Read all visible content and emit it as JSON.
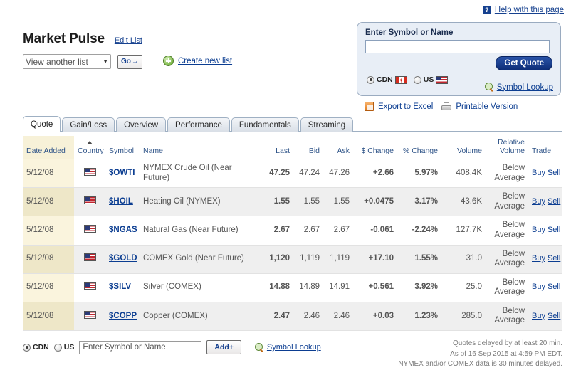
{
  "help": {
    "icon": "question-mark-icon",
    "label": "Help with this page"
  },
  "header": {
    "title": "Market Pulse",
    "edit_list_label": "Edit List",
    "list_select_value": "View another list",
    "go_label": "Go",
    "go_arrow": "→",
    "create_new_list_label": "Create new list"
  },
  "quote_box": {
    "label": "Enter Symbol or Name",
    "input_value": "",
    "get_quote_label": "Get Quote",
    "radio_cdn_label": "CDN",
    "radio_us_label": "US",
    "selected_market": "CDN",
    "symbol_lookup_label": "Symbol Lookup"
  },
  "export": {
    "excel_label": "Export to Excel",
    "printable_label": "Printable Version"
  },
  "tabs": [
    {
      "label": "Quote",
      "active": true
    },
    {
      "label": "Gain/Loss",
      "active": false
    },
    {
      "label": "Overview",
      "active": false
    },
    {
      "label": "Performance",
      "active": false
    },
    {
      "label": "Fundamentals",
      "active": false
    },
    {
      "label": "Streaming",
      "active": false
    }
  ],
  "table": {
    "columns": {
      "date_added": "Date Added",
      "country": "Country",
      "symbol": "Symbol",
      "name": "Name",
      "last": "Last",
      "bid": "Bid",
      "ask": "Ask",
      "dollar_change": "$ Change",
      "percent_change": "% Change",
      "volume": "Volume",
      "relative_volume": "Relative Volume",
      "trade": "Trade"
    },
    "sorted_by": "Date Added",
    "sort_direction": "asc",
    "trade_buy_label": "Buy",
    "trade_sell_label": "Sell",
    "rows": [
      {
        "date_added": "5/12/08",
        "country": "US",
        "symbol": "$OWTI",
        "name": "NYMEX Crude Oil (Near Future)",
        "last": "47.25",
        "bid": "47.24",
        "ask": "47.26",
        "dollar_change": "+2.66",
        "percent_change": "5.97%",
        "direction": "up",
        "volume": "408.4K",
        "relative_volume": "Below Average"
      },
      {
        "date_added": "5/12/08",
        "country": "US",
        "symbol": "$HOIL",
        "name": "Heating Oil (NYMEX)",
        "last": "1.55",
        "bid": "1.55",
        "ask": "1.55",
        "dollar_change": "+0.0475",
        "percent_change": "3.17%",
        "direction": "up",
        "volume": "43.6K",
        "relative_volume": "Below Average"
      },
      {
        "date_added": "5/12/08",
        "country": "US",
        "symbol": "$NGAS",
        "name": "Natural Gas (Near Future)",
        "last": "2.67",
        "bid": "2.67",
        "ask": "2.67",
        "dollar_change": "-0.061",
        "percent_change": "-2.24%",
        "direction": "down",
        "volume": "127.7K",
        "relative_volume": "Below Average"
      },
      {
        "date_added": "5/12/08",
        "country": "US",
        "symbol": "$GOLD",
        "name": "COMEX Gold (Near Future)",
        "last": "1,120",
        "bid": "1,119",
        "ask": "1,119",
        "dollar_change": "+17.10",
        "percent_change": "1.55%",
        "direction": "up",
        "volume": "31.0",
        "relative_volume": "Below Average"
      },
      {
        "date_added": "5/12/08",
        "country": "US",
        "symbol": "$SILV",
        "name": "Silver (COMEX)",
        "last": "14.88",
        "bid": "14.89",
        "ask": "14.91",
        "dollar_change": "+0.561",
        "percent_change": "3.92%",
        "direction": "up",
        "volume": "25.0",
        "relative_volume": "Below Average"
      },
      {
        "date_added": "5/12/08",
        "country": "US",
        "symbol": "$COPP",
        "name": "Copper (COMEX)",
        "last": "2.47",
        "bid": "2.46",
        "ask": "2.46",
        "dollar_change": "+0.03",
        "percent_change": "1.23%",
        "direction": "up",
        "volume": "285.0",
        "relative_volume": "Below Average"
      }
    ]
  },
  "add_bar": {
    "radio_cdn_label": "CDN",
    "radio_us_label": "US",
    "selected_market": "CDN",
    "input_placeholder": "Enter Symbol or Name",
    "input_value": "",
    "add_label": "Add+",
    "symbol_lookup_label": "Symbol Lookup"
  },
  "disclaimer": {
    "line1": "Quotes delayed by at least 20 min.",
    "line2": "As of 16 Sep 2015 at 4:59 PM EDT.",
    "line3": "NYMEX and/or COMEX data is 30 minutes delayed."
  },
  "colors": {
    "link": "#0b3d91",
    "up": "#1f7a1f",
    "down": "#b32020",
    "quote_box_bg": "#e8eef6",
    "sorted_column_bg": "#faf4dd"
  }
}
